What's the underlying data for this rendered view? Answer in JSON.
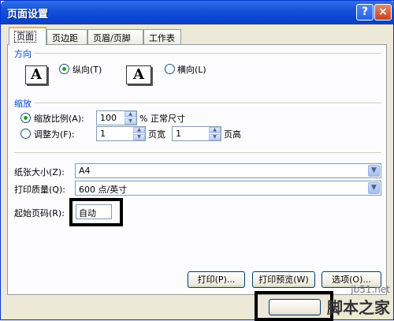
{
  "window": {
    "title": "页面设置",
    "help": "?",
    "close": "×"
  },
  "tabs": [
    {
      "label": "页面"
    },
    {
      "label": "页边距"
    },
    {
      "label": "页眉/页脚"
    },
    {
      "label": "工作表"
    }
  ],
  "orientation": {
    "section_title": "方向",
    "portrait_label": "纵向(T)",
    "landscape_label": "横向(L)",
    "selected": "portrait",
    "icon_letter": "A"
  },
  "scaling": {
    "section_title": "缩放",
    "zoom_label": "缩放比例(A):",
    "zoom_value": "100",
    "zoom_suffix": "% 正常尺寸",
    "fit_label": "调整为(F):",
    "fit_wide_value": "1",
    "fit_wide_suffix": "页宽",
    "fit_tall_value": "1",
    "fit_tall_suffix": "页高",
    "selected": "zoom"
  },
  "paper_size": {
    "label": "纸张大小(Z):",
    "value": "A4"
  },
  "print_quality": {
    "label": "打印质量(Q):",
    "value": "600 点/英寸"
  },
  "first_page": {
    "label": "起始页码(R):",
    "value": "自动"
  },
  "buttons": {
    "print": "打印(P)...",
    "preview": "打印预览(W)",
    "options": "选项(O)..."
  },
  "watermark": {
    "top": "jb51.net",
    "bottom": "脚本之家"
  }
}
